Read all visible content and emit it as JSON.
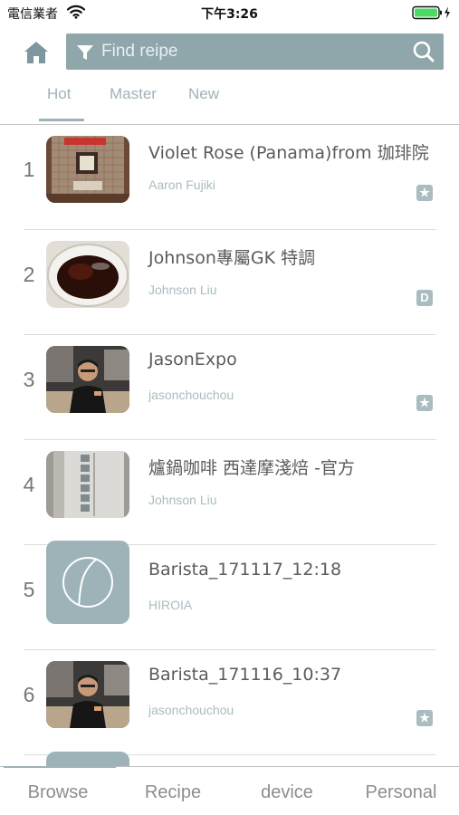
{
  "status_bar": {
    "carrier": "電信業者",
    "time": "下午3:26",
    "wifi_icon": "wifi-icon",
    "battery_icon": "battery-charging-icon"
  },
  "header": {
    "home_icon": "home-icon",
    "search": {
      "placeholder": "Find reipe",
      "filter_icon": "filter-icon",
      "search_icon": "search-icon"
    }
  },
  "tabs": [
    {
      "label": "Hot",
      "active": true
    },
    {
      "label": "Master",
      "active": false
    },
    {
      "label": "New",
      "active": false
    }
  ],
  "recipes": [
    {
      "rank": "1",
      "title": "Violet Rose (Panama)from 珈琲院",
      "author": "Aaron Fujiki",
      "badge": "★",
      "badge_icon": "star-badge-icon",
      "thumb": "coffee-bag-photo"
    },
    {
      "rank": "2",
      "title": "Johnson專屬GK 特調",
      "author": "Johnson Liu",
      "badge": "D",
      "badge_icon": "d-badge-icon",
      "thumb": "coffee-cup-photo"
    },
    {
      "rank": "3",
      "title": "JasonExpo",
      "author": "jasonchouchou",
      "badge": "★",
      "badge_icon": "star-badge-icon",
      "thumb": "barista-photo"
    },
    {
      "rank": "4",
      "title": "爐鍋咖啡 西達摩淺焙 -官方",
      "author": "Johnson Liu",
      "badge": "",
      "badge_icon": "",
      "thumb": "coffee-package-photo"
    },
    {
      "rank": "5",
      "title": "Barista_171117_12:18",
      "author": "HIROIA",
      "badge": "",
      "badge_icon": "",
      "thumb": "hiroia-logo"
    },
    {
      "rank": "6",
      "title": "Barista_171116_10:37",
      "author": "jasonchouchou",
      "badge": "★",
      "badge_icon": "star-badge-icon",
      "thumb": "barista-photo"
    }
  ],
  "bottom_tabs": [
    {
      "label": "Browse",
      "active": true
    },
    {
      "label": "Recipe",
      "active": false
    },
    {
      "label": "device",
      "active": false
    },
    {
      "label": "Personal",
      "active": false
    }
  ],
  "colors": {
    "accent": "#8fa6ab",
    "accent_light": "#a9bcc0",
    "text_primary": "#5b5b5b",
    "tab_inactive": "#8e8e8e",
    "battery": "#4cd964"
  }
}
